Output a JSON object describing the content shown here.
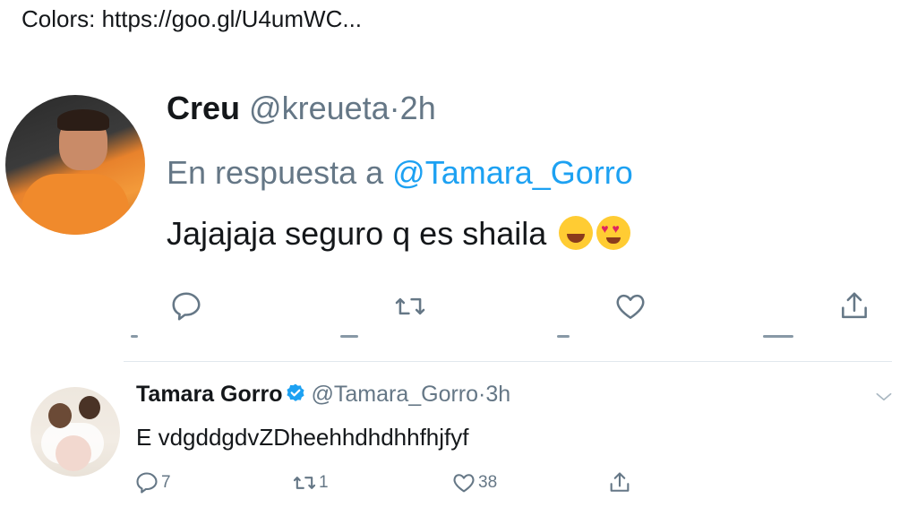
{
  "top_snippet": "Colors: https://goo.gl/U4umWC...",
  "tweet1": {
    "name": "Creu",
    "handle": "@kreueta",
    "dot": "·",
    "time": "2h",
    "reply_prefix": "En respuesta a",
    "reply_mention": "@Tamara_Gorro",
    "text": "Jajajaja seguro q es shaila",
    "emojis": [
      "tears-of-joy-emoji",
      "heart-eyes-emoji"
    ],
    "actions": [
      "reply-icon",
      "retweet-icon",
      "like-icon",
      "share-icon"
    ]
  },
  "tweet2": {
    "name": "Tamara Gorro",
    "verified": true,
    "handle": "@Tamara_Gorro",
    "dot": "·",
    "time": "3h",
    "text": "E vdgddgdvZDheehhdhdhhfhjfyf",
    "reply_count": "7",
    "retweet_count": "1",
    "like_count": "38"
  },
  "colors": {
    "text": "#14171a",
    "secondary": "#657786",
    "link": "#1da1f2",
    "divider": "#e1e8ed"
  }
}
